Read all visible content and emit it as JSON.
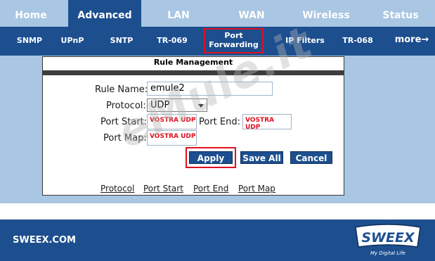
{
  "top_tabs": [
    {
      "label": "Home",
      "active": false
    },
    {
      "label": "Advanced",
      "active": true
    },
    {
      "label": "LAN",
      "active": false
    },
    {
      "label": "WAN",
      "active": false
    },
    {
      "label": "Wireless",
      "active": false
    },
    {
      "label": "Status",
      "active": false
    }
  ],
  "sub_nav": {
    "snmp": "SNMP",
    "upnp": "UPnP",
    "sntp": "SNTP",
    "tr069": "TR-069",
    "port_forwarding_line1": "Port",
    "port_forwarding_line2": "Forwarding",
    "ip_filters": "IP Filters",
    "tr068": "TR-068",
    "more": "more→"
  },
  "panel": {
    "title": "Rule Management",
    "rule_name_label": "Rule Name:",
    "rule_name_value": "emule2",
    "protocol_label": "Protocol:",
    "protocol_value": "UDP",
    "port_start_label": "Port Start:",
    "port_start_value": "VOSTRA UDP",
    "port_end_label": "Port End:",
    "port_end_value": "VOSTRA UDP",
    "port_map_label": "Port Map:",
    "port_map_value": "VOSTRA UDP"
  },
  "buttons": {
    "apply": "Apply",
    "save_all": "Save All",
    "cancel": "Cancel"
  },
  "links": {
    "protocol": "Protocol",
    "port_start": "Port Start",
    "port_end": "Port End",
    "port_map": "Port Map"
  },
  "watermark": "eMule.it",
  "footer": {
    "site": "SWEEX.COM",
    "logo_text": "SWEEX",
    "tagline": "My Digital Life"
  },
  "colors": {
    "dark_blue": "#1d4f8f",
    "light_blue": "#a9c6e2",
    "highlight_red": "#e01020"
  }
}
